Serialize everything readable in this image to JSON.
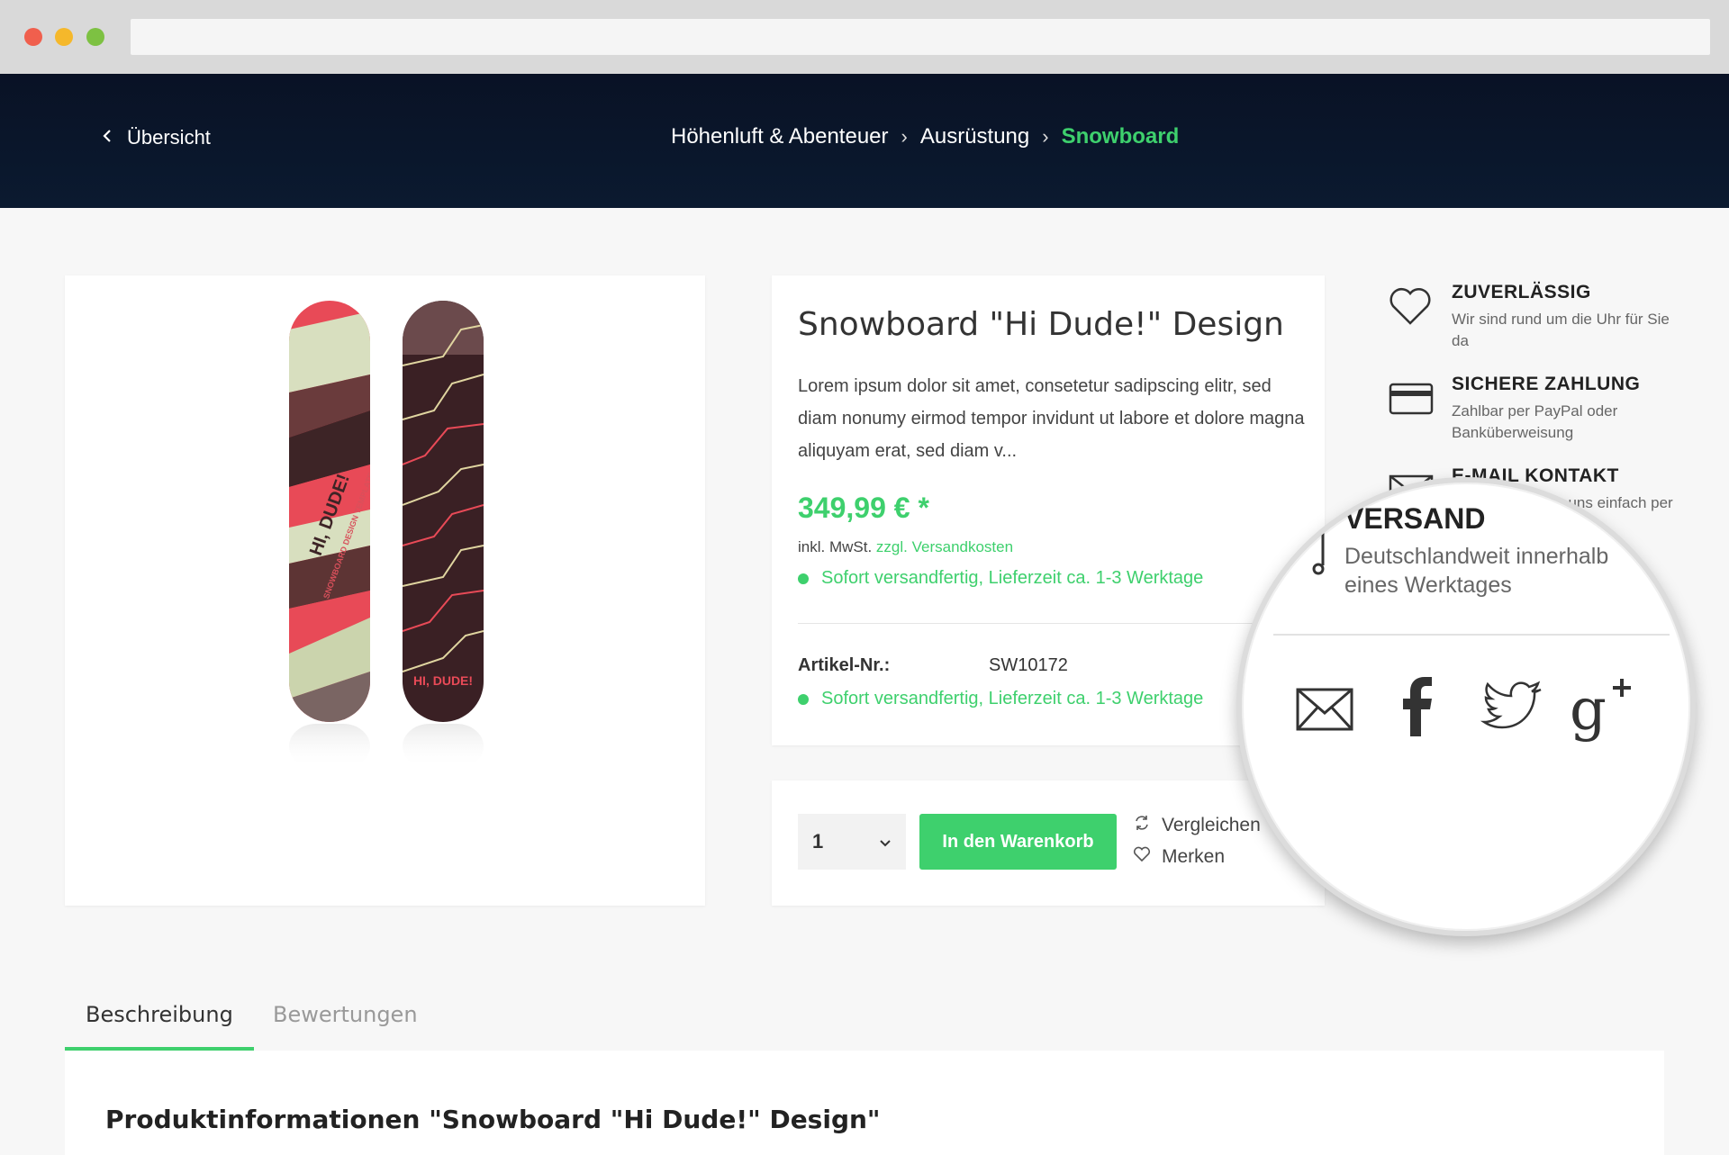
{
  "hero": {
    "back_label": "Übersicht",
    "breadcrumb": [
      "Höhenluft & Abenteuer",
      "Ausrüstung",
      "Snowboard"
    ]
  },
  "product": {
    "title": "Snowboard \"Hi Dude!\" Design",
    "description": "Lorem ipsum dolor sit amet, consetetur sadipscing elitr, sed diam nonumy eirmod tempor invidunt ut labore et dolore magna aliquyam erat, sed diam v...",
    "price": "349,99 € *",
    "tax_prefix": "inkl. MwSt.",
    "tax_link": "zzgl. Versandkosten",
    "delivery_status": "Sofort versandfertig, Lieferzeit ca. 1-3 Werktage",
    "sku_label": "Artikel-Nr.:",
    "sku_value": "SW10172",
    "board_text_left": "HI, DUDE!",
    "board_subtext_left": "SNOWBOARD DESIGN TEMPLATE",
    "board_text_right": "HI, DUDE!"
  },
  "buy": {
    "quantity": "1",
    "cart_button": "In den Warenkorb",
    "compare_label": "Vergleichen",
    "remember_label": "Merken"
  },
  "features": [
    {
      "title": "ZUVERLÄSSIG",
      "text": "Wir sind rund um die Uhr für Sie da",
      "icon": "heart-icon"
    },
    {
      "title": "SICHERE ZAHLUNG",
      "text": "Zahlbar per PayPal oder Banküberweisung",
      "icon": "credit-card-icon"
    },
    {
      "title": "E-MAIL KONTAKT",
      "text": "Kontaktieren Sie uns einfach per E-Mail",
      "icon": "envelope-icon"
    }
  ],
  "magnifier": {
    "title": "VERSAND",
    "text": "Deutschlandweit innerhalb eines Werktages",
    "share_icons": [
      "mail-icon",
      "facebook-icon",
      "twitter-icon",
      "google-plus-icon"
    ]
  },
  "tabs": {
    "description": "Beschreibung",
    "reviews": "Bewertungen"
  },
  "panel": {
    "title": "Produktinformationen \"Snowboard \"Hi Dude!\" Design\""
  },
  "colors": {
    "accent": "#3ed06d",
    "hero_bg": "#091225",
    "page_bg": "#f7f7f7"
  }
}
